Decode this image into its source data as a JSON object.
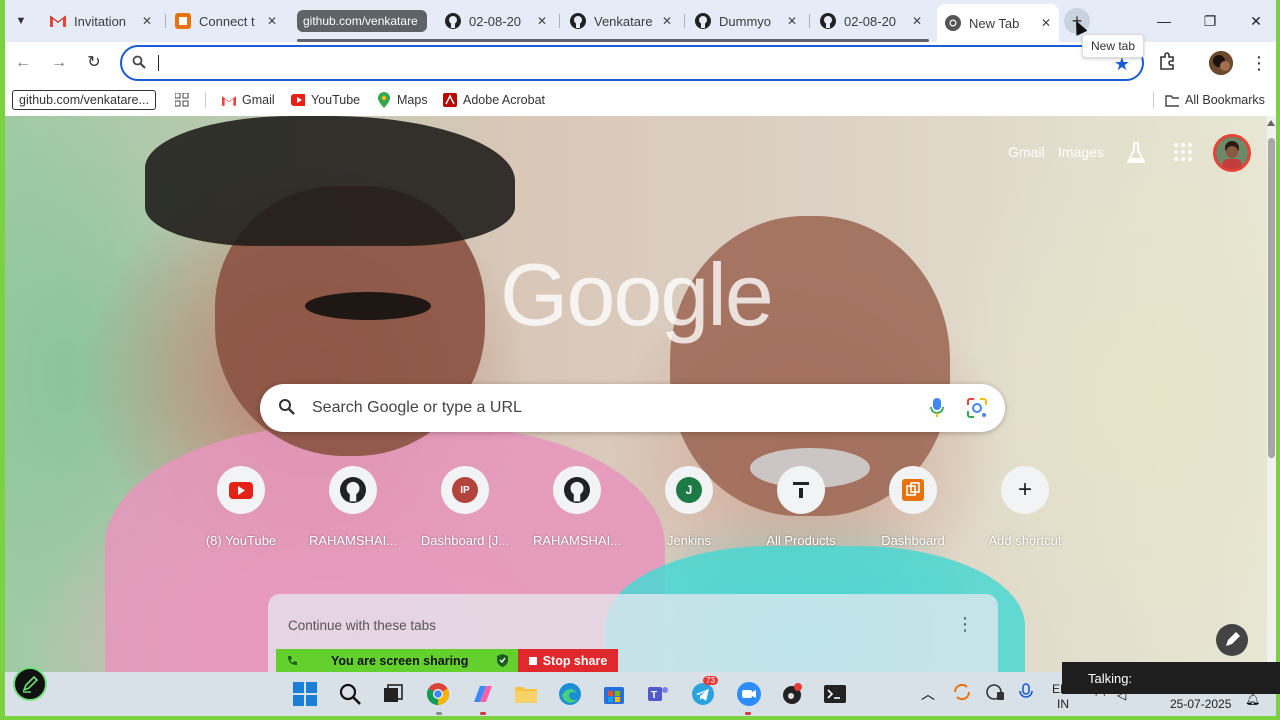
{
  "tabs": [
    {
      "title": "Invitation",
      "icon": "gmail-icon"
    },
    {
      "title": "Connect t",
      "icon": "connect-icon"
    },
    {
      "title": "github.com/venkatare",
      "icon": "",
      "group": true
    },
    {
      "title": "02-08-20",
      "icon": "github-icon"
    },
    {
      "title": "Venkatare",
      "icon": "github-icon"
    },
    {
      "title": "Dummyo",
      "icon": "github-icon"
    },
    {
      "title": "02-08-20",
      "icon": "github-icon"
    },
    {
      "title": "New Tab",
      "icon": "chrome-icon",
      "active": true
    }
  ],
  "tooltip": "New tab",
  "bookmarks": {
    "first": "github.com/venkatare...",
    "items": [
      {
        "label": "Gmail",
        "icon": "gmail-icon"
      },
      {
        "label": "YouTube",
        "icon": "youtube-icon"
      },
      {
        "label": "Maps",
        "icon": "maps-icon"
      },
      {
        "label": "Adobe Acrobat",
        "icon": "acrobat-icon"
      }
    ],
    "all": "All Bookmarks"
  },
  "ntp": {
    "logo": "Google",
    "gmail": "Gmail",
    "images": "Images",
    "search_placeholder": "Search Google or type a URL",
    "shortcuts": [
      {
        "label": "(8) YouTube",
        "icon": "youtube-icon"
      },
      {
        "label": "RAHAMSHAI...",
        "icon": "github-icon"
      },
      {
        "label": "Dashboard [J...",
        "icon": "ip-icon",
        "letter": "IP"
      },
      {
        "label": "RAHAMSHAI...",
        "icon": "github-icon"
      },
      {
        "label": "Jenkins",
        "icon": "jenkins-icon",
        "letter": "J"
      },
      {
        "label": "All Products",
        "icon": "all-products-icon"
      },
      {
        "label": "Dashboard",
        "icon": "dashboard-icon"
      },
      {
        "label": "Add shortcut",
        "icon": "plus-icon"
      }
    ],
    "continue": "Continue with these tabs"
  },
  "share": {
    "sharing": "You are screen sharing",
    "stop": "Stop share"
  },
  "taskbar": {
    "lang1": "EN",
    "lang2": "IN",
    "date": "25-07-2025",
    "talking": "Talking:",
    "telegram_badge": "73"
  },
  "colors": {
    "accent": "#1a5bd6",
    "frame": "#7cd13e",
    "stop_red": "#e0292c",
    "share_green": "#63d02e"
  }
}
